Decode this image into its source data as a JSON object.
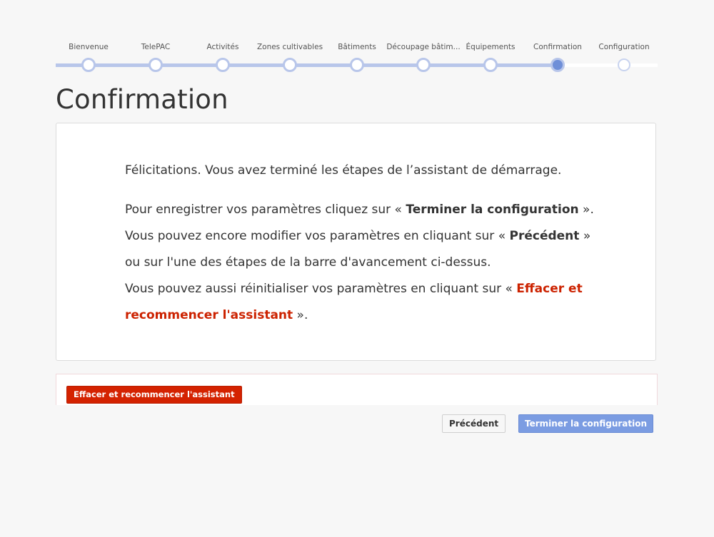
{
  "stepper": {
    "steps": [
      {
        "label": "Bienvenue",
        "state": "done"
      },
      {
        "label": "TelePAC",
        "state": "done"
      },
      {
        "label": "Activités",
        "state": "done"
      },
      {
        "label": "Zones cultivables",
        "state": "done"
      },
      {
        "label": "Bâtiments",
        "state": "done"
      },
      {
        "label": "Découpage bâtim...",
        "state": "done"
      },
      {
        "label": "Équipements",
        "state": "done"
      },
      {
        "label": "Confirmation",
        "state": "current"
      },
      {
        "label": "Configuration",
        "state": "pending"
      }
    ]
  },
  "page": {
    "title": "Confirmation"
  },
  "message": {
    "line1": "Félicitations. Vous avez terminé les étapes de l’assistant de démarrage.",
    "line2_prefix": "Pour enregistrer vos paramètres cliquez sur « ",
    "line2_bold": "Terminer la configuration",
    "line2_suffix": " ».",
    "line3_prefix": "Vous pouvez encore modifier vos paramètres en cliquant sur « ",
    "line3_bold": "Précédent",
    "line3_suffix": " »",
    "line4": "ou sur l'une des étapes de la barre d'avancement ci-dessus.",
    "line5_prefix": "Vous pouvez aussi réinitialiser vos paramètres en cliquant sur « ",
    "line5_red": "Effacer et recommencer l'assistant",
    "line5_suffix": " »."
  },
  "actions": {
    "reset_label": "Effacer et recommencer l'assistant",
    "previous_label": "Précédent",
    "finish_label": "Terminer la configuration"
  },
  "colors": {
    "accent": "#7b9ce2",
    "danger": "#d42200",
    "progress_track": "#b8c6ea",
    "current_step": "#6f8fd8"
  }
}
